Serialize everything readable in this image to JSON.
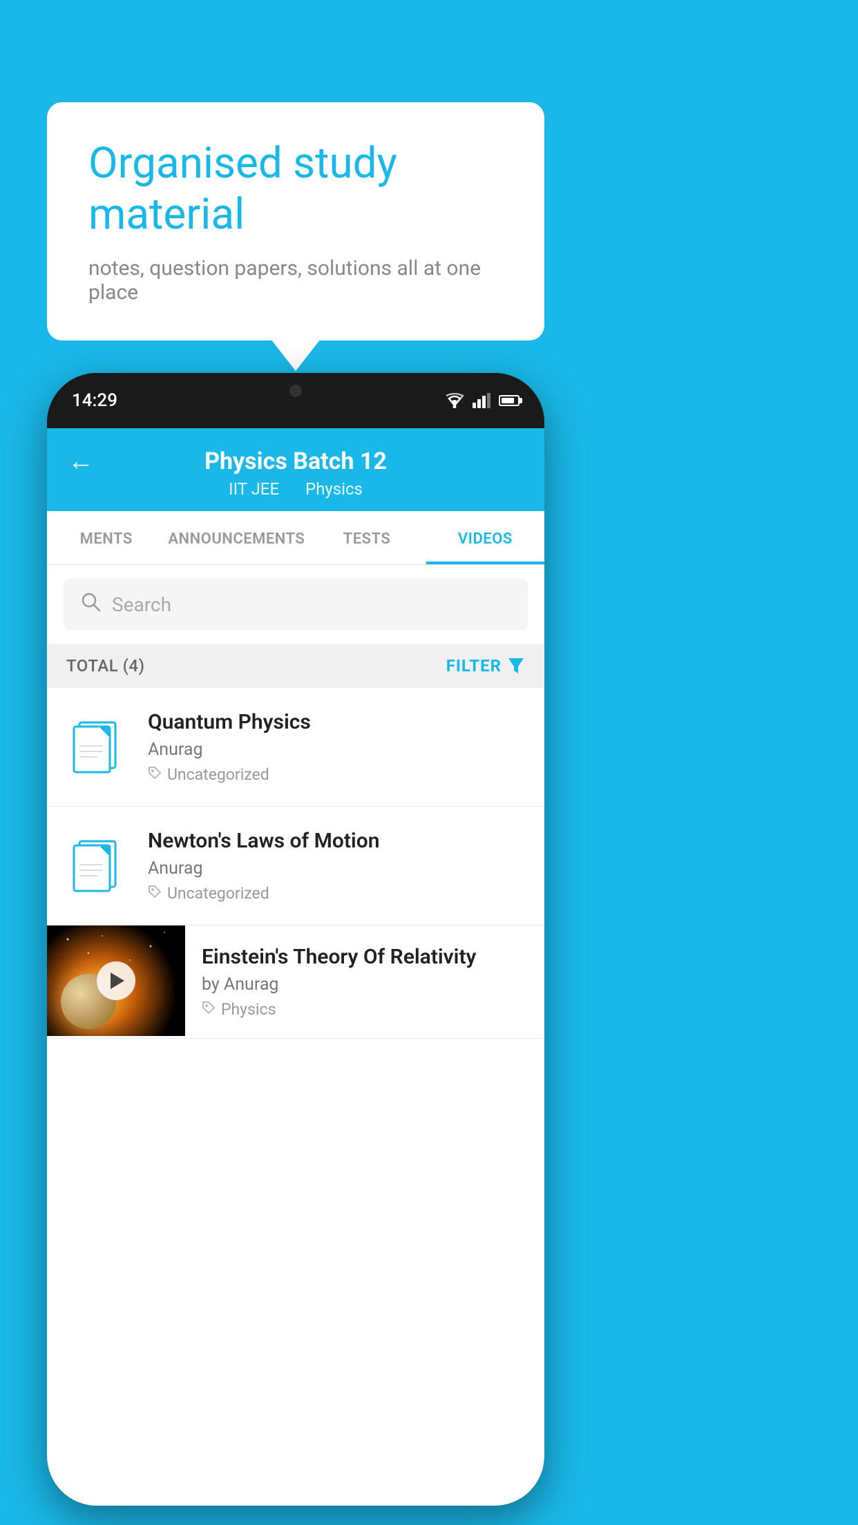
{
  "background": {
    "color": "#1ab8e8"
  },
  "speech_bubble": {
    "title": "Organised study material",
    "subtitle": "notes, question papers, solutions all at one place"
  },
  "phone": {
    "status_bar": {
      "time": "14:29"
    },
    "app_bar": {
      "title": "Physics Batch 12",
      "subtitle_parts": [
        "IIT JEE",
        "Physics"
      ],
      "back_label": "←"
    },
    "tabs": [
      {
        "label": "MENTS",
        "active": false
      },
      {
        "label": "ANNOUNCEMENTS",
        "active": false
      },
      {
        "label": "TESTS",
        "active": false
      },
      {
        "label": "VIDEOS",
        "active": true
      }
    ],
    "search": {
      "placeholder": "Search"
    },
    "filter_bar": {
      "total_label": "TOTAL (4)",
      "filter_label": "FILTER"
    },
    "videos": [
      {
        "title": "Quantum Physics",
        "author": "Anurag",
        "tag": "Uncategorized",
        "has_thumbnail": false
      },
      {
        "title": "Newton's Laws of Motion",
        "author": "Anurag",
        "tag": "Uncategorized",
        "has_thumbnail": false
      },
      {
        "title": "Einstein's Theory Of Relativity",
        "author": "by Anurag",
        "tag": "Physics",
        "has_thumbnail": true
      }
    ]
  }
}
